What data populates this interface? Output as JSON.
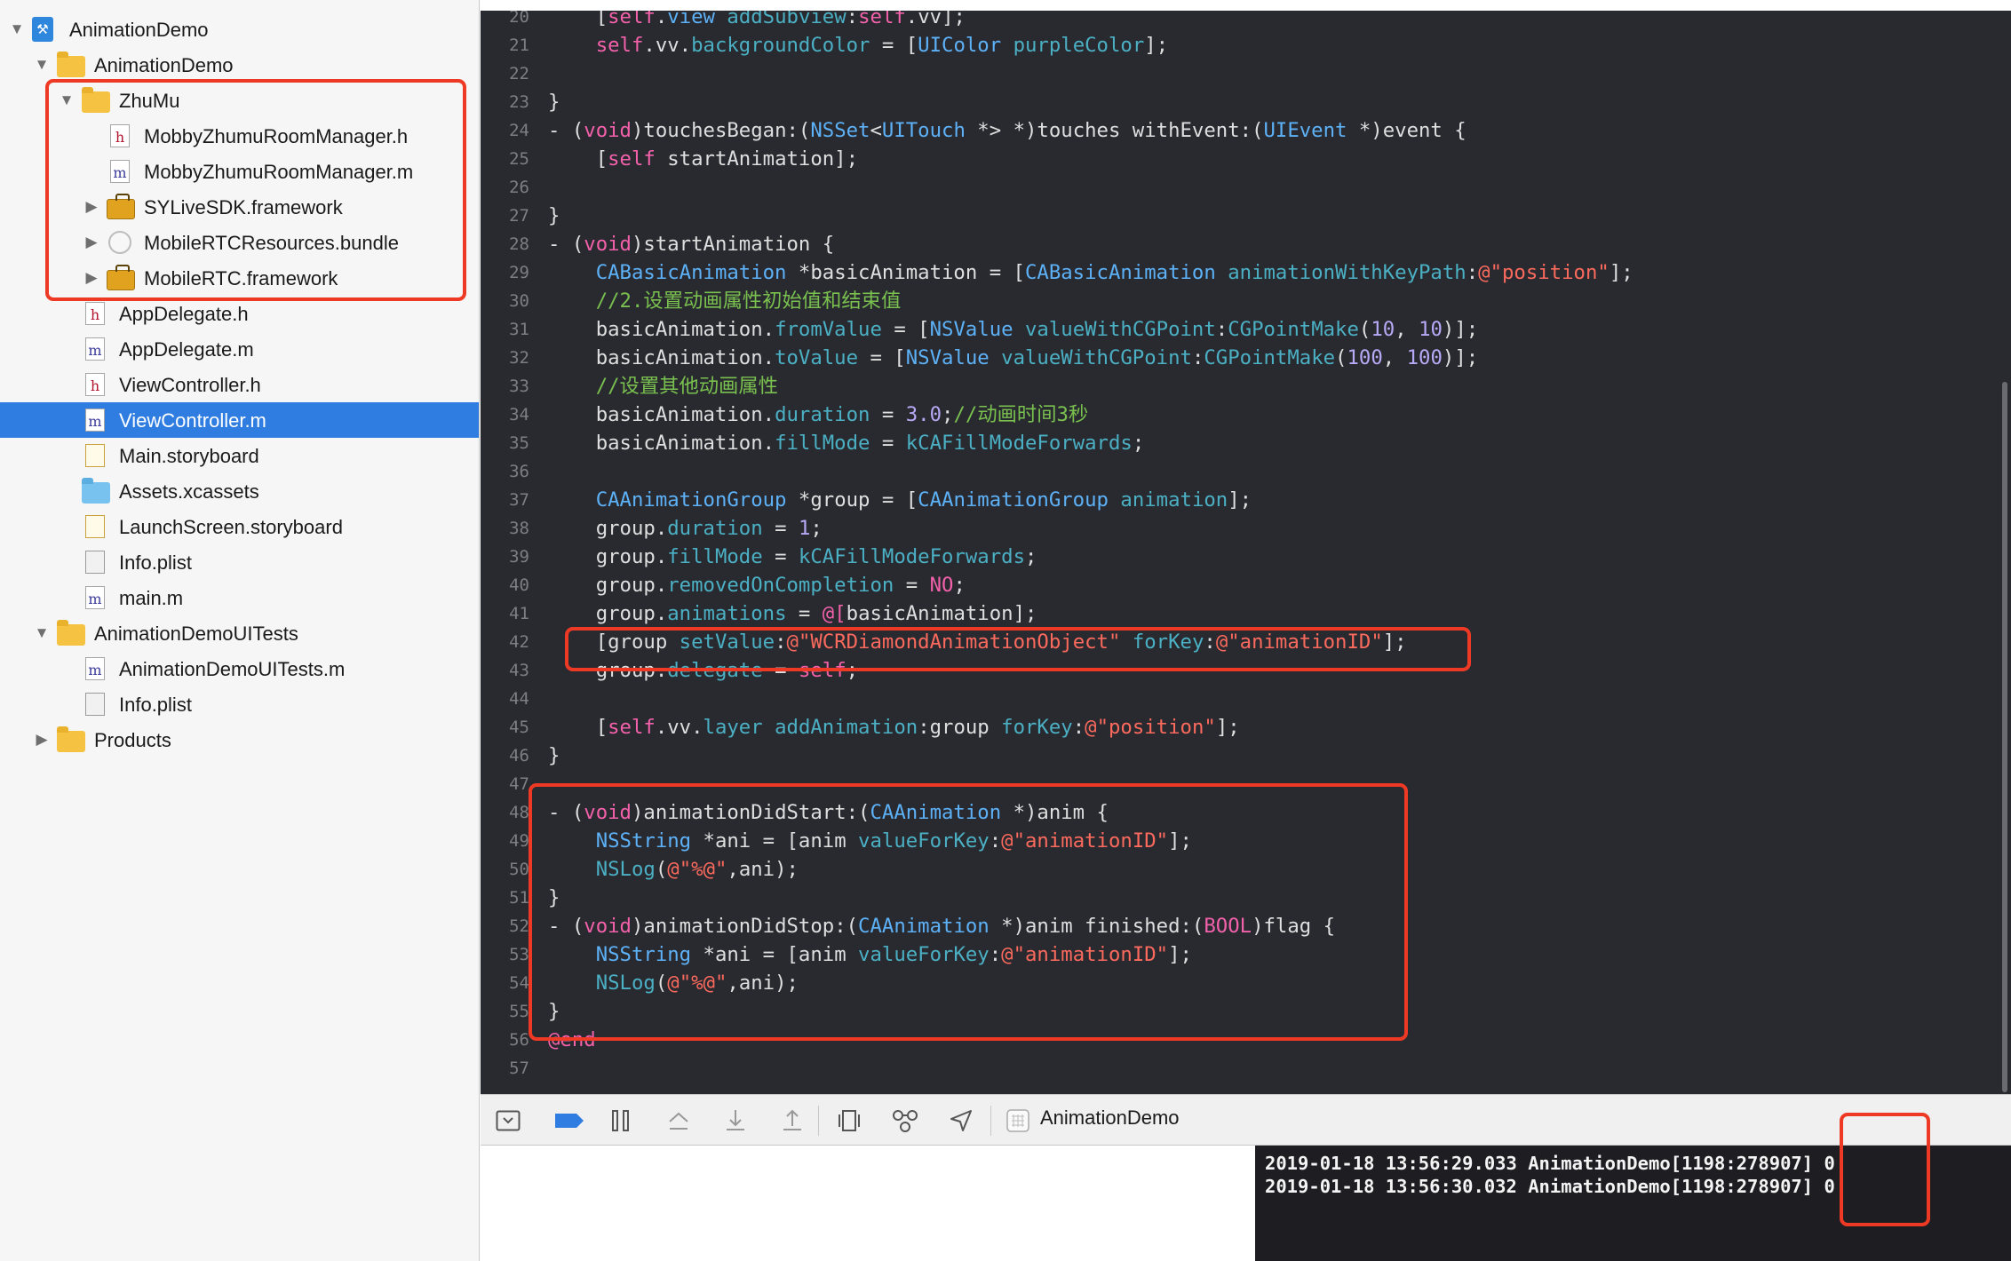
{
  "navigator": {
    "items": [
      {
        "label": "AnimationDemo",
        "icon": "project-icon",
        "disclosure": "open"
      },
      {
        "label": "AnimationDemo",
        "icon": "folder-icon",
        "disclosure": "open"
      },
      {
        "label": "ZhuMu",
        "icon": "folder-icon",
        "disclosure": "open"
      },
      {
        "label": "MobbyZhumuRoomManager.h",
        "icon": "header-file-icon"
      },
      {
        "label": "MobbyZhumuRoomManager.m",
        "icon": "source-file-icon"
      },
      {
        "label": "SYLiveSDK.framework",
        "icon": "framework-icon",
        "disclosure": "closed"
      },
      {
        "label": "MobileRTCResources.bundle",
        "icon": "bundle-icon",
        "disclosure": "closed"
      },
      {
        "label": "MobileRTC.framework",
        "icon": "framework-icon",
        "disclosure": "closed"
      },
      {
        "label": "AppDelegate.h",
        "icon": "header-file-icon"
      },
      {
        "label": "AppDelegate.m",
        "icon": "source-file-icon"
      },
      {
        "label": "ViewController.h",
        "icon": "header-file-icon"
      },
      {
        "label": "ViewController.m",
        "icon": "source-file-icon",
        "selected": true
      },
      {
        "label": "Main.storyboard",
        "icon": "storyboard-icon"
      },
      {
        "label": "Assets.xcassets",
        "icon": "asset-catalog-icon"
      },
      {
        "label": "LaunchScreen.storyboard",
        "icon": "storyboard-icon"
      },
      {
        "label": "Info.plist",
        "icon": "plist-icon"
      },
      {
        "label": "main.m",
        "icon": "source-file-icon"
      },
      {
        "label": "AnimationDemoUITests",
        "icon": "folder-icon",
        "disclosure": "open"
      },
      {
        "label": "AnimationDemoUITests.m",
        "icon": "source-file-icon"
      },
      {
        "label": "Info.plist",
        "icon": "plist-icon"
      },
      {
        "label": "Products",
        "icon": "folder-icon",
        "disclosure": "closed"
      }
    ],
    "file_glyphs": {
      "header": "h",
      "source": "m"
    }
  },
  "editor": {
    "line_numbers": [
      "20",
      "21",
      "22",
      "23",
      "24",
      "25",
      "26",
      "27",
      "28",
      "29",
      "30",
      "31",
      "32",
      "33",
      "34",
      "35",
      "36",
      "37",
      "38",
      "39",
      "40",
      "41",
      "42",
      "43",
      "44",
      "45",
      "46",
      "47",
      "48",
      "49",
      "50",
      "51",
      "52",
      "53",
      "54",
      "55",
      "56",
      "57"
    ],
    "lines": [
      [
        {
          "t": "    [",
          "c": ""
        },
        {
          "t": "self",
          "c": "kw"
        },
        {
          "t": ".",
          "c": ""
        },
        {
          "t": "view",
          "c": "ty"
        },
        {
          "t": " ",
          "c": ""
        },
        {
          "t": "addSubview",
          "c": "me"
        },
        {
          "t": ":",
          "c": ""
        },
        {
          "t": "self",
          "c": "kw"
        },
        {
          "t": ".vv];",
          "c": ""
        }
      ],
      [
        {
          "t": "    ",
          "c": ""
        },
        {
          "t": "self",
          "c": "kw"
        },
        {
          "t": ".vv.",
          "c": ""
        },
        {
          "t": "backgroundColor",
          "c": "me"
        },
        {
          "t": " = [",
          "c": ""
        },
        {
          "t": "UIColor",
          "c": "ty"
        },
        {
          "t": " ",
          "c": ""
        },
        {
          "t": "purpleColor",
          "c": "me"
        },
        {
          "t": "];",
          "c": ""
        }
      ],
      [],
      [
        {
          "t": "}",
          "c": ""
        }
      ],
      [
        {
          "t": "- (",
          "c": ""
        },
        {
          "t": "void",
          "c": "kw"
        },
        {
          "t": ")touchesBegan:(",
          "c": ""
        },
        {
          "t": "NSSet",
          "c": "ty"
        },
        {
          "t": "<",
          "c": ""
        },
        {
          "t": "UITouch",
          "c": "ty"
        },
        {
          "t": " *> *)touches withEvent:(",
          "c": ""
        },
        {
          "t": "UIEvent",
          "c": "ty"
        },
        {
          "t": " *)event {",
          "c": ""
        }
      ],
      [
        {
          "t": "    [",
          "c": ""
        },
        {
          "t": "self",
          "c": "kw"
        },
        {
          "t": " startAnimation];",
          "c": ""
        }
      ],
      [],
      [
        {
          "t": "}",
          "c": ""
        }
      ],
      [
        {
          "t": "- (",
          "c": ""
        },
        {
          "t": "void",
          "c": "kw"
        },
        {
          "t": ")startAnimation {",
          "c": ""
        }
      ],
      [
        {
          "t": "    ",
          "c": ""
        },
        {
          "t": "CABasicAnimation",
          "c": "ty"
        },
        {
          "t": " *basicAnimation = [",
          "c": ""
        },
        {
          "t": "CABasicAnimation",
          "c": "ty"
        },
        {
          "t": " ",
          "c": ""
        },
        {
          "t": "animationWithKeyPath",
          "c": "me"
        },
        {
          "t": ":",
          "c": ""
        },
        {
          "t": "@\"position\"",
          "c": "st"
        },
        {
          "t": "];",
          "c": ""
        }
      ],
      [
        {
          "t": "    ",
          "c": ""
        },
        {
          "t": "//2.设置动画属性初始值和结束值",
          "c": "cm"
        }
      ],
      [
        {
          "t": "    basicAnimation.",
          "c": ""
        },
        {
          "t": "fromValue",
          "c": "me"
        },
        {
          "t": " = [",
          "c": ""
        },
        {
          "t": "NSValue",
          "c": "ty"
        },
        {
          "t": " ",
          "c": ""
        },
        {
          "t": "valueWithCGPoint",
          "c": "me"
        },
        {
          "t": ":",
          "c": ""
        },
        {
          "t": "CGPointMake",
          "c": "me"
        },
        {
          "t": "(",
          "c": ""
        },
        {
          "t": "10",
          "c": "nu"
        },
        {
          "t": ", ",
          "c": ""
        },
        {
          "t": "10",
          "c": "nu"
        },
        {
          "t": ")];",
          "c": ""
        }
      ],
      [
        {
          "t": "    basicAnimation.",
          "c": ""
        },
        {
          "t": "toValue",
          "c": "me"
        },
        {
          "t": " = [",
          "c": ""
        },
        {
          "t": "NSValue",
          "c": "ty"
        },
        {
          "t": " ",
          "c": ""
        },
        {
          "t": "valueWithCGPoint",
          "c": "me"
        },
        {
          "t": ":",
          "c": ""
        },
        {
          "t": "CGPointMake",
          "c": "me"
        },
        {
          "t": "(",
          "c": ""
        },
        {
          "t": "100",
          "c": "nu"
        },
        {
          "t": ", ",
          "c": ""
        },
        {
          "t": "100",
          "c": "nu"
        },
        {
          "t": ")];",
          "c": ""
        }
      ],
      [
        {
          "t": "    ",
          "c": ""
        },
        {
          "t": "//设置其他动画属性",
          "c": "cm"
        }
      ],
      [
        {
          "t": "    basicAnimation.",
          "c": ""
        },
        {
          "t": "duration",
          "c": "me"
        },
        {
          "t": " = ",
          "c": ""
        },
        {
          "t": "3.0",
          "c": "nu"
        },
        {
          "t": ";",
          "c": ""
        },
        {
          "t": "//动画时间3秒",
          "c": "cm"
        }
      ],
      [
        {
          "t": "    basicAnimation.",
          "c": ""
        },
        {
          "t": "fillMode",
          "c": "me"
        },
        {
          "t": " = ",
          "c": ""
        },
        {
          "t": "kCAFillModeForwards",
          "c": "me"
        },
        {
          "t": ";",
          "c": ""
        }
      ],
      [],
      [
        {
          "t": "    ",
          "c": ""
        },
        {
          "t": "CAAnimationGroup",
          "c": "ty"
        },
        {
          "t": " *group = [",
          "c": ""
        },
        {
          "t": "CAAnimationGroup",
          "c": "ty"
        },
        {
          "t": " ",
          "c": ""
        },
        {
          "t": "animation",
          "c": "me"
        },
        {
          "t": "];",
          "c": ""
        }
      ],
      [
        {
          "t": "    group.",
          "c": ""
        },
        {
          "t": "duration",
          "c": "me"
        },
        {
          "t": " = ",
          "c": ""
        },
        {
          "t": "1",
          "c": "nu"
        },
        {
          "t": ";",
          "c": ""
        }
      ],
      [
        {
          "t": "    group.",
          "c": ""
        },
        {
          "t": "fillMode",
          "c": "me"
        },
        {
          "t": " = ",
          "c": ""
        },
        {
          "t": "kCAFillModeForwards",
          "c": "me"
        },
        {
          "t": ";",
          "c": ""
        }
      ],
      [
        {
          "t": "    group.",
          "c": ""
        },
        {
          "t": "removedOnCompletion",
          "c": "me"
        },
        {
          "t": " = ",
          "c": ""
        },
        {
          "t": "NO",
          "c": "kw"
        },
        {
          "t": ";",
          "c": ""
        }
      ],
      [
        {
          "t": "    group.",
          "c": ""
        },
        {
          "t": "animations",
          "c": "me"
        },
        {
          "t": " = ",
          "c": ""
        },
        {
          "t": "@[",
          "c": "kw"
        },
        {
          "t": "basicAnimation",
          "c": ""
        },
        {
          "t": "];",
          "c": ""
        }
      ],
      [
        {
          "t": "    [group ",
          "c": ""
        },
        {
          "t": "setValue",
          "c": "me"
        },
        {
          "t": ":",
          "c": ""
        },
        {
          "t": "@\"WCRDiamondAnimationObject\"",
          "c": "st"
        },
        {
          "t": " ",
          "c": ""
        },
        {
          "t": "forKey",
          "c": "me"
        },
        {
          "t": ":",
          "c": ""
        },
        {
          "t": "@\"animationID\"",
          "c": "st"
        },
        {
          "t": "];",
          "c": ""
        }
      ],
      [
        {
          "t": "    group.",
          "c": ""
        },
        {
          "t": "delegate",
          "c": "me"
        },
        {
          "t": " = ",
          "c": ""
        },
        {
          "t": "self",
          "c": "kw"
        },
        {
          "t": ";",
          "c": ""
        }
      ],
      [],
      [
        {
          "t": "    [",
          "c": ""
        },
        {
          "t": "self",
          "c": "kw"
        },
        {
          "t": ".vv.",
          "c": ""
        },
        {
          "t": "layer",
          "c": "me"
        },
        {
          "t": " ",
          "c": ""
        },
        {
          "t": "addAnimation",
          "c": "me"
        },
        {
          "t": ":group ",
          "c": ""
        },
        {
          "t": "forKey",
          "c": "me"
        },
        {
          "t": ":",
          "c": ""
        },
        {
          "t": "@\"position\"",
          "c": "st"
        },
        {
          "t": "];",
          "c": ""
        }
      ],
      [
        {
          "t": "}",
          "c": ""
        }
      ],
      [],
      [
        {
          "t": "- (",
          "c": ""
        },
        {
          "t": "void",
          "c": "kw"
        },
        {
          "t": ")animationDidStart:(",
          "c": ""
        },
        {
          "t": "CAAnimation",
          "c": "ty"
        },
        {
          "t": " *)anim {",
          "c": ""
        }
      ],
      [
        {
          "t": "    ",
          "c": ""
        },
        {
          "t": "NSString",
          "c": "ty"
        },
        {
          "t": " *ani = [anim ",
          "c": ""
        },
        {
          "t": "valueForKey",
          "c": "me"
        },
        {
          "t": ":",
          "c": ""
        },
        {
          "t": "@\"animationID\"",
          "c": "st"
        },
        {
          "t": "];",
          "c": ""
        }
      ],
      [
        {
          "t": "    ",
          "c": ""
        },
        {
          "t": "NSLog",
          "c": "me"
        },
        {
          "t": "(",
          "c": ""
        },
        {
          "t": "@\"%@\"",
          "c": "st"
        },
        {
          "t": ",ani);",
          "c": ""
        }
      ],
      [
        {
          "t": "}",
          "c": ""
        }
      ],
      [
        {
          "t": "- (",
          "c": ""
        },
        {
          "t": "void",
          "c": "kw"
        },
        {
          "t": ")animationDidStop:(",
          "c": ""
        },
        {
          "t": "CAAnimation",
          "c": "ty"
        },
        {
          "t": " *)anim finished:(",
          "c": ""
        },
        {
          "t": "BOOL",
          "c": "kw"
        },
        {
          "t": ")flag {",
          "c": ""
        }
      ],
      [
        {
          "t": "    ",
          "c": ""
        },
        {
          "t": "NSString",
          "c": "ty"
        },
        {
          "t": " *ani = [anim ",
          "c": ""
        },
        {
          "t": "valueForKey",
          "c": "me"
        },
        {
          "t": ":",
          "c": ""
        },
        {
          "t": "@\"animationID\"",
          "c": "st"
        },
        {
          "t": "];",
          "c": ""
        }
      ],
      [
        {
          "t": "    ",
          "c": ""
        },
        {
          "t": "NSLog",
          "c": "me"
        },
        {
          "t": "(",
          "c": ""
        },
        {
          "t": "@\"%@\"",
          "c": "st"
        },
        {
          "t": ",ani);",
          "c": ""
        }
      ],
      [
        {
          "t": "}",
          "c": ""
        }
      ],
      [
        {
          "t": "@end",
          "c": "kw"
        }
      ],
      []
    ]
  },
  "debug_toolbar": {
    "buttons": [
      "hide-debug-area-icon",
      "breakpoints-toggle-icon",
      "pause-icon",
      "step-over-icon",
      "step-into-icon",
      "step-out-icon",
      "view-hierarchy-icon",
      "memory-graph-icon",
      "simulate-location-icon"
    ],
    "scheme_label": "AnimationDemo"
  },
  "console": {
    "lines": [
      "2019-01-18 13:56:29.033 AnimationDemo[1198:278907] 0",
      "2019-01-18 13:56:30.032 AnimationDemo[1198:278907] 0"
    ]
  },
  "colors": {
    "selection": "#2f7de1",
    "editor_bg": "#292a30",
    "keyword": "#f361ab",
    "type": "#5db1f7",
    "method": "#4bb0c4",
    "string": "#fc6a5d",
    "number": "#b8a9f6",
    "comment": "#79c04f",
    "annotation_box": "#ee3a25"
  }
}
